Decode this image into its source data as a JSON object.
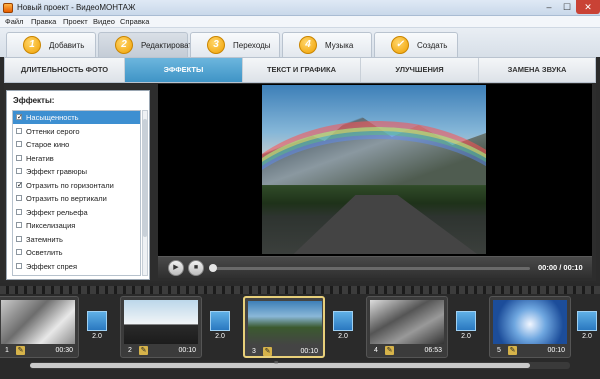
{
  "window": {
    "title": "Новый проект - ВидеоМОНТАЖ",
    "controls": {
      "min": "–",
      "max": "☐",
      "close": "✕"
    }
  },
  "menu": [
    "Файл",
    "Правка",
    "Проект",
    "Видео",
    "Справка"
  ],
  "steps": [
    {
      "num": "1",
      "label": "Добавить"
    },
    {
      "num": "2",
      "label": "Редактировать",
      "active": true
    },
    {
      "num": "3",
      "label": "Переходы"
    },
    {
      "num": "4",
      "label": "Музыка"
    },
    {
      "num": "✓",
      "label": "Создать"
    }
  ],
  "tabs": [
    {
      "label": "ДЛИТЕЛЬНОСТЬ ФОТО"
    },
    {
      "label": "ЭФФЕКТЫ",
      "active": true
    },
    {
      "label": "ТЕКСТ И ГРАФИКА"
    },
    {
      "label": "УЛУЧШЕНИЯ"
    },
    {
      "label": "ЗАМЕНА ЗВУКА"
    }
  ],
  "effects": {
    "title": "Эффекты:",
    "items": [
      {
        "label": "Насыщенность",
        "checked": true,
        "selected": true
      },
      {
        "label": "Оттенки серого",
        "checked": false
      },
      {
        "label": "Старое кино",
        "checked": false
      },
      {
        "label": "Негатив",
        "checked": false
      },
      {
        "label": "Эффект гравюры",
        "checked": false
      },
      {
        "label": "Отразить по горизонтали",
        "checked": true
      },
      {
        "label": "Отразить по вертикали",
        "checked": false
      },
      {
        "label": "Эффект рельефа",
        "checked": false
      },
      {
        "label": "Пикселизация",
        "checked": false
      },
      {
        "label": "Затемнить",
        "checked": false
      },
      {
        "label": "Осветлить",
        "checked": false
      },
      {
        "label": "Эффект спрея",
        "checked": false
      }
    ]
  },
  "player": {
    "time": "00:00 / 00:10",
    "play_icon": "▶",
    "stop_icon": "■"
  },
  "timeline": {
    "clips": [
      {
        "num": "1",
        "duration": "00:30"
      },
      {
        "num": "2",
        "duration": "00:10"
      },
      {
        "num": "3",
        "duration": "00:10",
        "active": true
      },
      {
        "num": "4",
        "duration": "06:53"
      },
      {
        "num": "5",
        "duration": "00:10"
      }
    ],
    "transitions": [
      "2.0",
      "2.0",
      "2.0",
      "2.0",
      "2.0"
    ],
    "scroll_grip": "≡"
  },
  "colors": {
    "accent": "#3f94c6",
    "selected_row": "#3d8fd1",
    "active_clip_border": "#e8d07a"
  }
}
